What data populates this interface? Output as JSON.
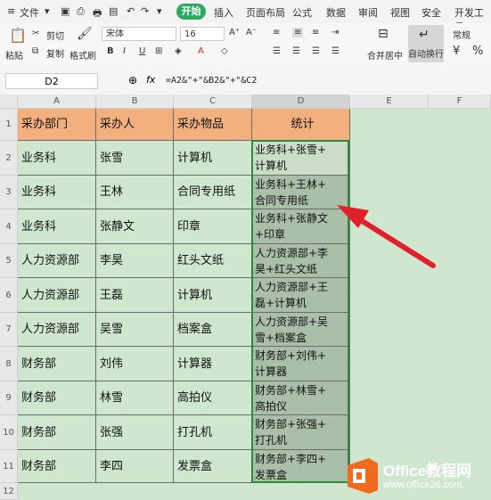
{
  "menu": {
    "file": "文件",
    "start": "开始",
    "tabs": [
      "插入",
      "页面布局",
      "公式",
      "数据",
      "审阅",
      "视图",
      "安全",
      "开发工具"
    ]
  },
  "ribbon": {
    "paste": "粘贴",
    "cut": "剪切",
    "copy": "复制",
    "format_painter": "格式刷",
    "font_name": "宋体",
    "font_size": "16",
    "merge_center": "合并居中",
    "auto_wrap": "自动换行",
    "number_format": "常规"
  },
  "formula_bar": {
    "name_box": "D2",
    "fx": "fx",
    "formula": "=A2&\"+\"&B2&\"+\"&C2"
  },
  "columns": [
    "A",
    "B",
    "C",
    "D",
    "E",
    "F"
  ],
  "rows": [
    "1",
    "2",
    "3",
    "4",
    "5",
    "6",
    "7",
    "8",
    "9",
    "10",
    "11",
    "12"
  ],
  "headers": [
    "采办部门",
    "采办人",
    "采办物品",
    "统计"
  ],
  "data": [
    [
      "业务科",
      "张雪",
      "计算机",
      "业务科+张雪+",
      "计算机"
    ],
    [
      "业务科",
      "王林",
      "合同专用纸",
      "业务科+王林+",
      "合同专用纸"
    ],
    [
      "业务科",
      "张静文",
      "印章",
      "业务科+张静文",
      "+印章"
    ],
    [
      "人力资源部",
      "李昊",
      "红头文纸",
      "人力资源部+李",
      "昊+红头文纸"
    ],
    [
      "人力资源部",
      "王磊",
      "计算机",
      "人力资源部+王",
      "磊+计算机"
    ],
    [
      "人力资源部",
      "吴雪",
      "档案盒",
      "人力资源部+吴",
      "雪+档案盒"
    ],
    [
      "财务部",
      "刘伟",
      "计算器",
      "财务部+刘伟+",
      "计算器"
    ],
    [
      "财务部",
      "林雪",
      "高拍仪",
      "财务部+林雪+",
      "高拍仪"
    ],
    [
      "财务部",
      "张强",
      "打孔机",
      "财务部+张强+",
      "打孔机"
    ],
    [
      "财务部",
      "李四",
      "发票盒",
      "财务部+李四+",
      "发票盒"
    ]
  ],
  "watermark": {
    "brand": "Office教程网",
    "url": "www.office26.com"
  },
  "colors": {
    "header_fill": "#f3b07f",
    "sheet_bg": "#cfe6cf",
    "start_tab": "#2aa95f",
    "arrow": "#e0202a",
    "logo_orange": "#ef6b1f"
  }
}
